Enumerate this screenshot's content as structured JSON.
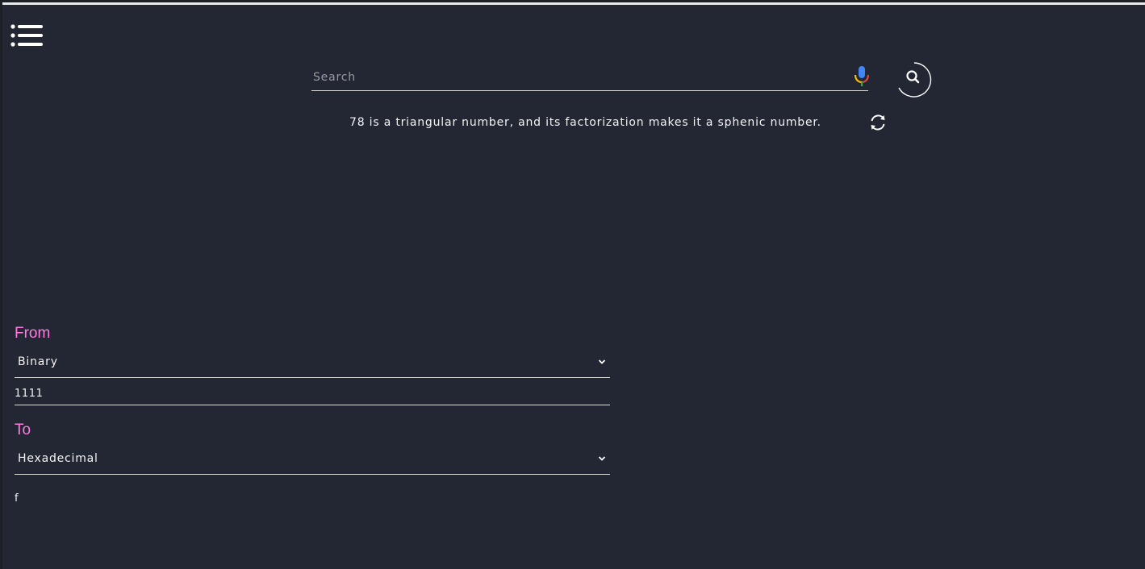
{
  "menu": {
    "icon": "menu-list-icon"
  },
  "search": {
    "placeholder": "Search",
    "value": "",
    "mic_icon": "microphone-icon",
    "button_icon": "search-icon"
  },
  "fact": {
    "text": "78 is a triangular number, and its factorization makes it a sphenic number.",
    "refresh_icon": "refresh-icon"
  },
  "converter": {
    "from": {
      "label": "From",
      "selected": "Binary",
      "value": "1111"
    },
    "to": {
      "label": "To",
      "selected": "Hexadecimal",
      "result": "f"
    }
  },
  "colors": {
    "background": "#232733",
    "accent": "#ff7be1",
    "text": "#f2f2f2"
  }
}
